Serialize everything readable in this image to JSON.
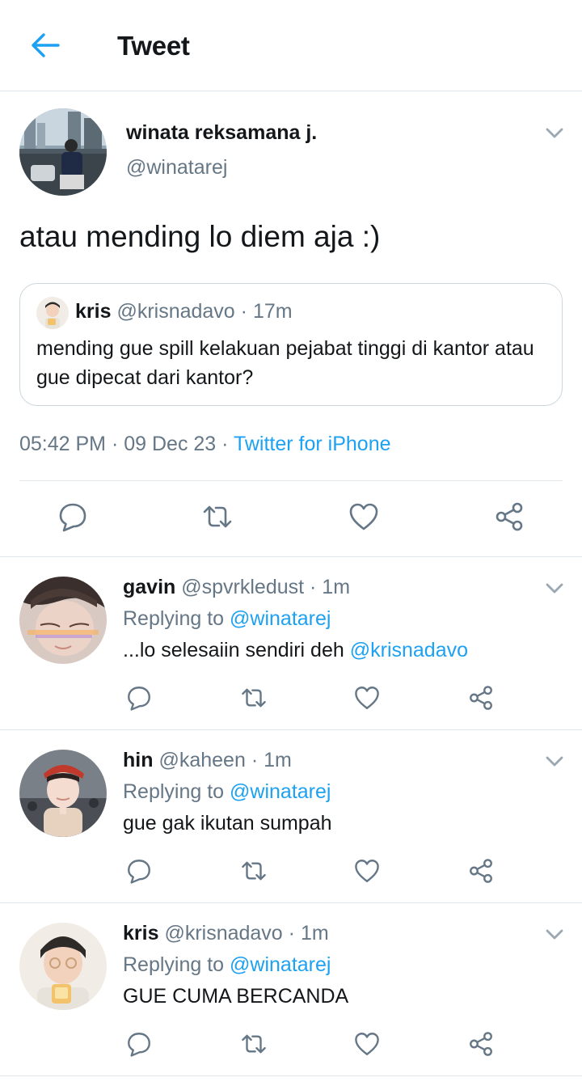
{
  "header": {
    "title": "Tweet"
  },
  "main_tweet": {
    "name": "winata reksamana j.",
    "handle": "@winatarej",
    "text": "atau mending lo diem aja :)",
    "quote": {
      "name": "kris",
      "handle": "@krisnadavo",
      "time": "· 17m",
      "text": "mending gue spill kelakuan pejabat tinggi di kantor atau gue dipecat dari kantor?"
    },
    "time": "05:42 PM",
    "date": "· 09 Dec 23 ·",
    "source": "Twitter for iPhone"
  },
  "replies": [
    {
      "name": "gavin",
      "handle": "@spvrkledust",
      "time": "· 1m",
      "replying_prefix": "Replying to",
      "replying_to": "@winatarej",
      "text": "...lo selesaiin sendiri deh",
      "text_mention": "@krisnadavo"
    },
    {
      "name": "hin",
      "handle": "@kaheen",
      "time": "· 1m",
      "replying_prefix": "Replying to",
      "replying_to": "@winatarej",
      "text": "gue gak ikutan sumpah",
      "text_mention": ""
    },
    {
      "name": "kris",
      "handle": "@krisnadavo",
      "time": "· 1m",
      "replying_prefix": "Replying to",
      "replying_to": "@winatarej",
      "text": "GUE CUMA BERCANDA",
      "text_mention": ""
    }
  ],
  "icons": {
    "back": "arrow-left-icon",
    "menu": "chevron-down-icon",
    "reply": "reply-bubble-icon",
    "retweet": "retweet-icon",
    "like": "heart-icon",
    "share": "share-icon"
  },
  "colors": {
    "accent": "#1da1f2",
    "secondary_text": "#657786",
    "icon_gray": "#657786",
    "divider": "#e1e8ed"
  }
}
